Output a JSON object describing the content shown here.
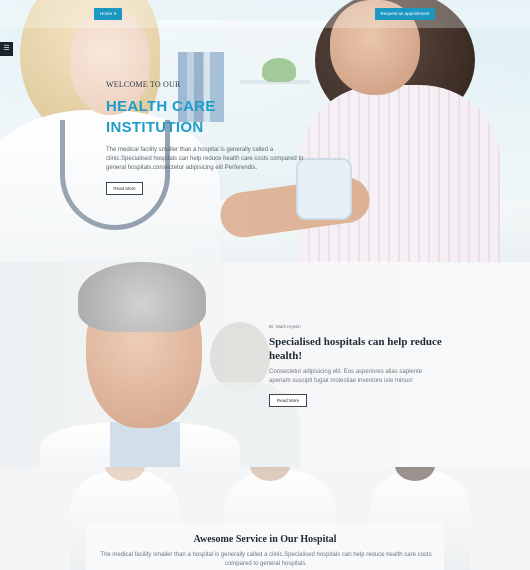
{
  "nav": {
    "home_label": "Home",
    "home_caret": "▾",
    "items": [
      "",
      "",
      "",
      "",
      ""
    ],
    "cta_label": "Request an appointment"
  },
  "side_toggle_icon": "sliders-icon",
  "hero": {
    "kicker": "WELCOME TO OUR",
    "title": "HEALTH CARE INSTITUTION",
    "description": "The medical facility smaller than a hospital is generally called a clinic.Specialised hospitals can help reduce health care costs compared to general hospitals.consectetur adipisicing elit Perferendis.",
    "button_label": "Read More"
  },
  "feature": {
    "author": "Dr. Mark Hyssin",
    "title": "Specialised hospitals can help reduce health!",
    "description": "Consectetur adipisicing elit. Eos asperiores alias sapiente aperiam suscipit fugiat molestiae inventore iste minus!",
    "button_label": "Read More"
  },
  "services": {
    "title": "Awesome Service in Our Hospital",
    "description": "The medical facility smaller than a hospital is generally called a clinic.Specialised hospitals can help reduce health care costs compared to general hospitals."
  },
  "colors": {
    "accent": "#1c97c1",
    "heading_dark": "#1f2a33"
  }
}
